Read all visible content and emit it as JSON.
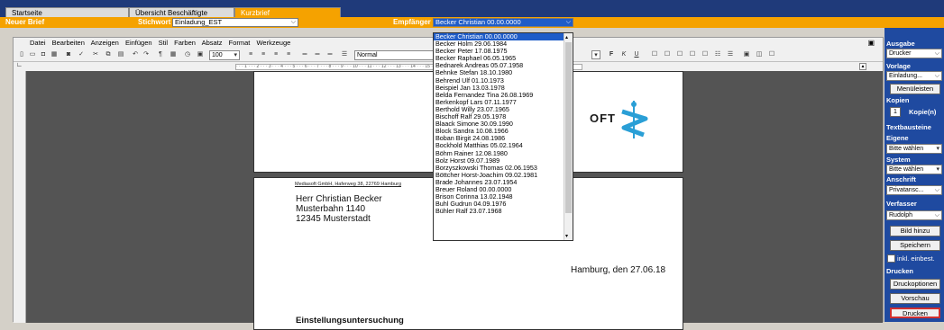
{
  "tabs": [
    {
      "label": "Startseite"
    },
    {
      "label": "Übersicht Beschäftigte"
    },
    {
      "label": "Kurzbrief"
    }
  ],
  "topbar": {
    "section_label": "Neuer Brief",
    "stichwort_label": "Stichwort",
    "stichwort_value": "Einladung_EST",
    "empfaenger_label": "Empfänger",
    "empfaenger_value": "Becker Christian  00.00.0000"
  },
  "menu": [
    "Datei",
    "Bearbeiten",
    "Anzeigen",
    "Einfügen",
    "Stil",
    "Farben",
    "Absatz",
    "Format",
    "Werkzeuge"
  ],
  "toolbar": {
    "zoom": "100",
    "style": "Normal"
  },
  "recipients": [
    "Becker Christian  00.00.0000",
    "Becker Holm  29.06.1984",
    "Becker Peter  17.08.1975",
    "Becker Raphael  06.05.1965",
    "Bednarek Andreas  05.07.1958",
    "Behnke Stefan  18.10.1980",
    "Behrend Ulf  01.10.1973",
    "Beispiel Jan  13.03.1978",
    "Belda Fernandez Tina  26.08.1969",
    "Berkenkopf Lars  07.11.1977",
    "Berthold Willy  23.07.1965",
    "Bischoff Ralf  29.05.1978",
    "Blaack Simone  30.09.1990",
    "Block Sandra  10.08.1966",
    "Boban Birgit  24.08.1986",
    "Bockhold Matthias  05.02.1964",
    "Böhm Rainer  12.08.1980",
    "Bolz Horst  09.07.1989",
    "Borzyszkowski Thomas  02.06.1953",
    "Böttcher Horst-Joachim  09.02.1981",
    "Brade Johannes  23.07.1954",
    "Breuer Roland  00.00.0000",
    "Brison Corinna  13.02.1948",
    "Buhl Gudrun  04.09.1976",
    "Bühler Ralf  23.07.1968"
  ],
  "letter": {
    "logo_text": "OFT",
    "sender_line": "Mediasoft GmbH, Haferweg 38, 22769 Hamburg",
    "recipient_name": "Herr Christian Becker",
    "recipient_street": "Musterbahn 1140",
    "recipient_city": "12345  Musterstadt",
    "date_line": "Hamburg, den 27.06.18",
    "subject": "Einstellungsuntersuchung"
  },
  "rightpanel": {
    "ausgabe_label": "Ausgabe",
    "ausgabe_value": "Drucker",
    "vorlage_label": "Vorlage",
    "vorlage_value": "Einladung...",
    "menuleisten": "Menüleisten",
    "kopien_label": "Kopien",
    "kopien_value": "1",
    "kopien_unit": "Kopie(n)",
    "textbausteine_label": "Textbausteine",
    "eigene_label": "Eigene",
    "eigene_value": "Bitte wählen",
    "system_label": "System",
    "system_value": "Bitte wählen",
    "anschrift_label": "Anschrift",
    "anschrift_value": "Privatansc...",
    "verfasser_label": "Verfasser",
    "verfasser_value": "Rudolph",
    "bild_hinzu": "Bild hinzu",
    "speichern": "Speichern",
    "inkl_label": "inkl. einbest.",
    "drucken_label": "Drucken",
    "druckoptionen": "Druckoptionen",
    "vorschau": "Vorschau",
    "drucken_btn": "Drucken"
  },
  "colors": {
    "accent": "#f5a200",
    "navy": "#1f3a7a",
    "panel": "#1f4aa0",
    "highlight": "#1f5cc8",
    "logo": "#2a9fd6"
  }
}
